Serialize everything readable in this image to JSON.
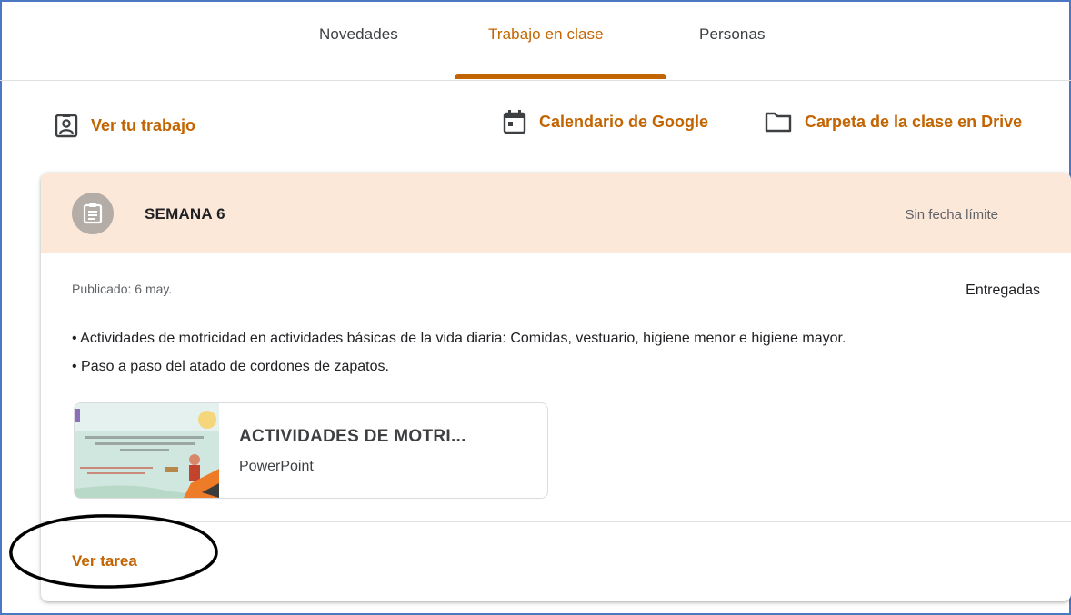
{
  "tabs": {
    "items": [
      {
        "label": "Novedades",
        "active": false
      },
      {
        "label": "Trabajo en clase",
        "active": true
      },
      {
        "label": "Personas",
        "active": false
      }
    ],
    "accent_color": "#c26401"
  },
  "actions": {
    "view_work": {
      "label": "Ver tu trabajo",
      "icon": "id-badge-icon"
    },
    "calendar": {
      "label": "Calendario de Google",
      "icon": "calendar-icon"
    },
    "drive_folder": {
      "label": "Carpeta de la clase en Drive",
      "icon": "folder-icon"
    }
  },
  "assignment": {
    "icon": "assignment-icon",
    "title": "SEMANA 6",
    "due": "Sin fecha límite",
    "published": "Publicado: 6 may.",
    "status": "Entregadas",
    "description": [
      "• Actividades de motricidad en actividades básicas de la vida diaria: Comidas, vestuario, higiene menor e higiene mayor.",
      "• Paso a paso del atado de cordones de zapatos."
    ],
    "attachment": {
      "title": "ACTIVIDADES DE MOTRI...",
      "type": "PowerPoint"
    },
    "view_link": "Ver tarea",
    "header_color": "#fce8d9"
  }
}
